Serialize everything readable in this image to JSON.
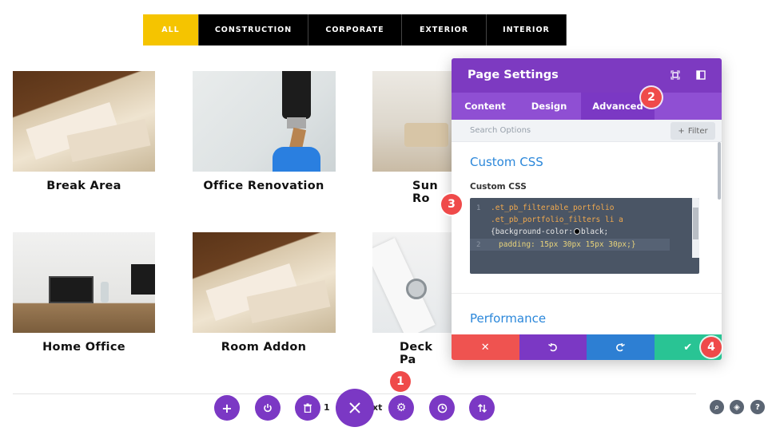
{
  "filters": [
    "ALL",
    "CONSTRUCTION",
    "CORPORATE",
    "EXTERIOR",
    "INTERIOR"
  ],
  "portfolio": [
    {
      "title": "Break Area"
    },
    {
      "title": "Office Renovation"
    },
    {
      "title": "Sun Ro"
    },
    {
      "title": "Home Office"
    },
    {
      "title": "Room Addon"
    },
    {
      "title": "Deck Pa"
    }
  ],
  "bottom_bar": {
    "page_partial": "1",
    "next_partial": "xt"
  },
  "modal": {
    "title": "Page Settings",
    "tabs": [
      "Content",
      "Design",
      "Advanced"
    ],
    "search_placeholder": "Search Options",
    "filter_label": "Filter",
    "section_custom_css": "Custom CSS",
    "field_label": "Custom CSS",
    "code_line1": ".et_pb_filterable_portfolio",
    "code_line1b": ".et_pb_portfolio_filters li a",
    "code_line1c_a": "{background-color:",
    "code_line1c_b": "black;",
    "code_line2": "padding: 15px 30px 15px 30px;}",
    "section_performance": "Performance"
  },
  "badges": [
    "1",
    "2",
    "3",
    "4"
  ],
  "colors": {
    "accent_purple": "#7d3ac1",
    "active_filter": "#f5c400",
    "cancel": "#ef5350",
    "undo": "#7b38c4",
    "redo": "#2d7fd3",
    "save": "#29c494",
    "link_blue": "#2b87da"
  },
  "icons": [
    "plus-icon",
    "power-icon",
    "trash-icon",
    "close-icon",
    "gear-icon",
    "clock-icon",
    "sort-icon",
    "search-icon",
    "layers-icon",
    "help-icon",
    "fullscreen-icon",
    "sidebar-icon",
    "undo-icon",
    "redo-icon",
    "check-icon"
  ]
}
